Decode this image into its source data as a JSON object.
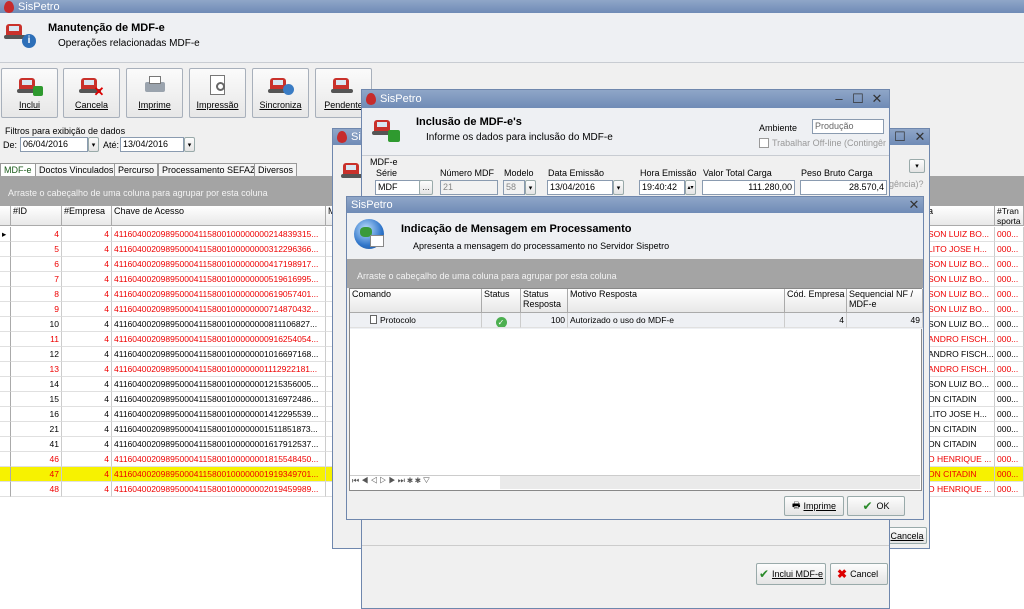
{
  "app": {
    "title": "SisPetro",
    "module_title": "Manutenção de MDF-e",
    "module_sub": "Operações relacionadas MDF-e"
  },
  "toolbar": [
    {
      "id": "inclui",
      "label": "Inclui"
    },
    {
      "id": "cancela",
      "label": "Cancela"
    },
    {
      "id": "imprime",
      "label": "Imprime"
    },
    {
      "id": "impressao",
      "label": "Impressão"
    },
    {
      "id": "sincroniza",
      "label": "Sincroniza"
    },
    {
      "id": "pendente",
      "label": "Pendente"
    }
  ],
  "filters": {
    "label": "Filtros para exibição de dados",
    "de_label": "De:",
    "de_value": "06/04/2016",
    "ate_label": "Até:",
    "ate_value": "13/04/2016"
  },
  "tabs": [
    "MDF-e",
    "Doctos Vinculados",
    "Percurso",
    "Processamento SEFAZ",
    "Diversos"
  ],
  "group_hint": "Arraste o cabeçalho de uma coluna para agrupar por esta coluna",
  "main_grid": {
    "headers": [
      "#ID",
      "#Empresa",
      "Chave de Acesso",
      "M"
    ],
    "right_headers": [
      "a",
      "#Tran sporta"
    ],
    "rows": [
      {
        "id": "4",
        "emp": "4",
        "key": "411604002098950004115800100000000214839315...",
        "name": "SON LUIZ BO...",
        "t": "000...",
        "red": true
      },
      {
        "id": "5",
        "emp": "4",
        "key": "411604002098950004115800100000000312296366...",
        "name": "LITO JOSE H...",
        "t": "000...",
        "red": true
      },
      {
        "id": "6",
        "emp": "4",
        "key": "411604002098950004115800100000000417198917...",
        "name": "SON LUIZ BO...",
        "t": "000...",
        "red": true
      },
      {
        "id": "7",
        "emp": "4",
        "key": "411604002098950004115800100000000519616995...",
        "name": "SON LUIZ BO...",
        "t": "000...",
        "red": true
      },
      {
        "id": "8",
        "emp": "4",
        "key": "411604002098950004115800100000000619057401...",
        "name": "SON LUIZ BO...",
        "t": "000...",
        "red": true
      },
      {
        "id": "9",
        "emp": "4",
        "key": "411604002098950004115800100000000714870432...",
        "name": "SON LUIZ BO...",
        "t": "000...",
        "red": true
      },
      {
        "id": "10",
        "emp": "4",
        "key": "411604002098950004115800100000000811106827...",
        "name": "SON LUIZ BO...",
        "t": "000...",
        "red": false
      },
      {
        "id": "11",
        "emp": "4",
        "key": "411604002098950004115800100000000916254054...",
        "name": "ANDRO FISCH...",
        "t": "000...",
        "red": true
      },
      {
        "id": "12",
        "emp": "4",
        "key": "411604002098950004115800100000001016697168...",
        "name": "ANDRO FISCH...",
        "t": "000...",
        "red": false
      },
      {
        "id": "13",
        "emp": "4",
        "key": "411604002098950004115800100000001112922181...",
        "name": "ANDRO FISCH...",
        "t": "000...",
        "red": true
      },
      {
        "id": "14",
        "emp": "4",
        "key": "411604002098950004115800100000001215356005...",
        "name": "SON LUIZ BO...",
        "t": "000...",
        "red": false
      },
      {
        "id": "15",
        "emp": "4",
        "key": "411604002098950004115800100000001316972486...",
        "name": "ON CITADIN",
        "t": "000...",
        "red": false
      },
      {
        "id": "16",
        "emp": "4",
        "key": "411604002098950004115800100000001412295539...",
        "name": "LITO JOSE H...",
        "t": "000...",
        "red": false
      },
      {
        "id": "21",
        "emp": "4",
        "key": "411604002098950004115800100000001511851873...",
        "name": "ON CITADIN",
        "t": "000...",
        "red": false
      },
      {
        "id": "41",
        "emp": "4",
        "key": "411604002098950004115800100000001617912537...",
        "name": "ON CITADIN",
        "t": "000...",
        "red": false
      },
      {
        "id": "46",
        "emp": "4",
        "key": "411604002098950004115800100000001815548450...",
        "name": "O HENRIQUE ...",
        "t": "000...",
        "red": true
      },
      {
        "id": "47",
        "emp": "4",
        "key": "411604002098950004115800100000001919349701...",
        "name": "ON CITADIN",
        "t": "000...",
        "red": true,
        "selected": true
      },
      {
        "id": "48",
        "emp": "4",
        "key": "411604002098950004115800100000002019459989...",
        "name": "O HENRIQUE ...",
        "t": "000...",
        "red": true
      }
    ]
  },
  "inclusao": {
    "title": "SisPetro",
    "heading": "Inclusão de MDF-e's",
    "sub": "Informe os dados para inclusão do MDF-e",
    "ambiente_label": "Ambiente",
    "ambiente_value": "Produção",
    "offline_label": "Trabalhar Off-line (Contingência)",
    "group": "MDF-e",
    "serie_label": "Série",
    "serie_value": "MDF",
    "numero_label": "Número MDF",
    "numero_value": "21",
    "modelo_label": "Modelo",
    "modelo_value": "58",
    "data_label": "Data Emissão",
    "data_value": "13/04/2016",
    "hora_label": "Hora Emissão",
    "hora_value": "19:40:42",
    "valor_label": "Valor Total Carga",
    "valor_value": "111.280,00",
    "peso_label": "Peso Bruto Carga",
    "peso_value": "28.570,4",
    "inclui_label": "Inclui MDF-e",
    "cancel_label": "Cancel"
  },
  "behind": {
    "title": "Sis",
    "partial": "gência)?",
    "cancela_label": "Cancela"
  },
  "msg": {
    "title": "SisPetro",
    "heading": "Indicação de Mensagem em Processamento",
    "sub": "Apresenta a mensagem do processamento no Servidor Sispetro",
    "group_hint": "Arraste o cabeçalho de uma coluna para agrupar por esta coluna",
    "headers": [
      "Comando",
      "Status",
      "Status Resposta",
      "Motivo Resposta",
      "Cód. Empresa",
      "Sequencial NF / MDF-e"
    ],
    "row": {
      "comando": "Protocolo",
      "status_resp": "100",
      "motivo": "Autorizado o uso do MDF-e",
      "empresa": "4",
      "seq": "49"
    },
    "imprime_label": "Imprime",
    "ok_label": "OK"
  }
}
